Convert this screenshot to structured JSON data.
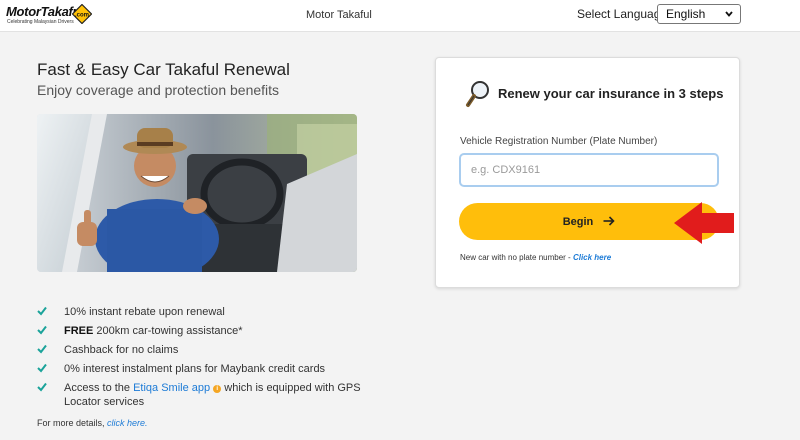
{
  "header": {
    "logo_text": "MotorTakaful",
    "logo_tagline": "Celebrating Malaysian Drivers",
    "logo_domain": ".com",
    "app_title": "Motor Takaful",
    "language_label": "Select Language",
    "language_value": "English"
  },
  "hero": {
    "title": "Fast & Easy Car Takaful Renewal",
    "subtitle": "Enjoy coverage and protection benefits",
    "photo_icon": "man-in-car-thumbs-up-photo"
  },
  "benefits": {
    "items": [
      {
        "plain": "10% instant rebate upon renewal"
      },
      {
        "bold": "FREE",
        "plain": " 200km car-towing assistance*"
      },
      {
        "plain": "Cashback for no claims"
      },
      {
        "plain": "0% interest instalment plans for Maybank credit cards"
      },
      {
        "pre": "Access to the ",
        "link": "Etiqa Smile app",
        "post": " which is equipped with GPS Locator services"
      }
    ],
    "more_prefix": "For more details, ",
    "more_link": "click here."
  },
  "card": {
    "title": "Renew your car insurance in 3 steps",
    "field_label": "Vehicle Registration Number (Plate Number)",
    "plate_placeholder": "e.g. CDX9161",
    "plate_value": "",
    "begin_label": "Begin",
    "newcar_prefix": "New car with no plate number - ",
    "newcar_link": "Click here"
  },
  "colors": {
    "accent_yellow": "#ffbe0b",
    "check_teal": "#1aa39a",
    "link_blue": "#1d7bd6",
    "annotation_red": "#e11c1c"
  },
  "icons": [
    "diamond-logo-icon",
    "chevron-down-icon",
    "magnifier-icon",
    "check-icon",
    "info-icon",
    "arrow-right-icon",
    "red-pointer-arrow-icon"
  ]
}
